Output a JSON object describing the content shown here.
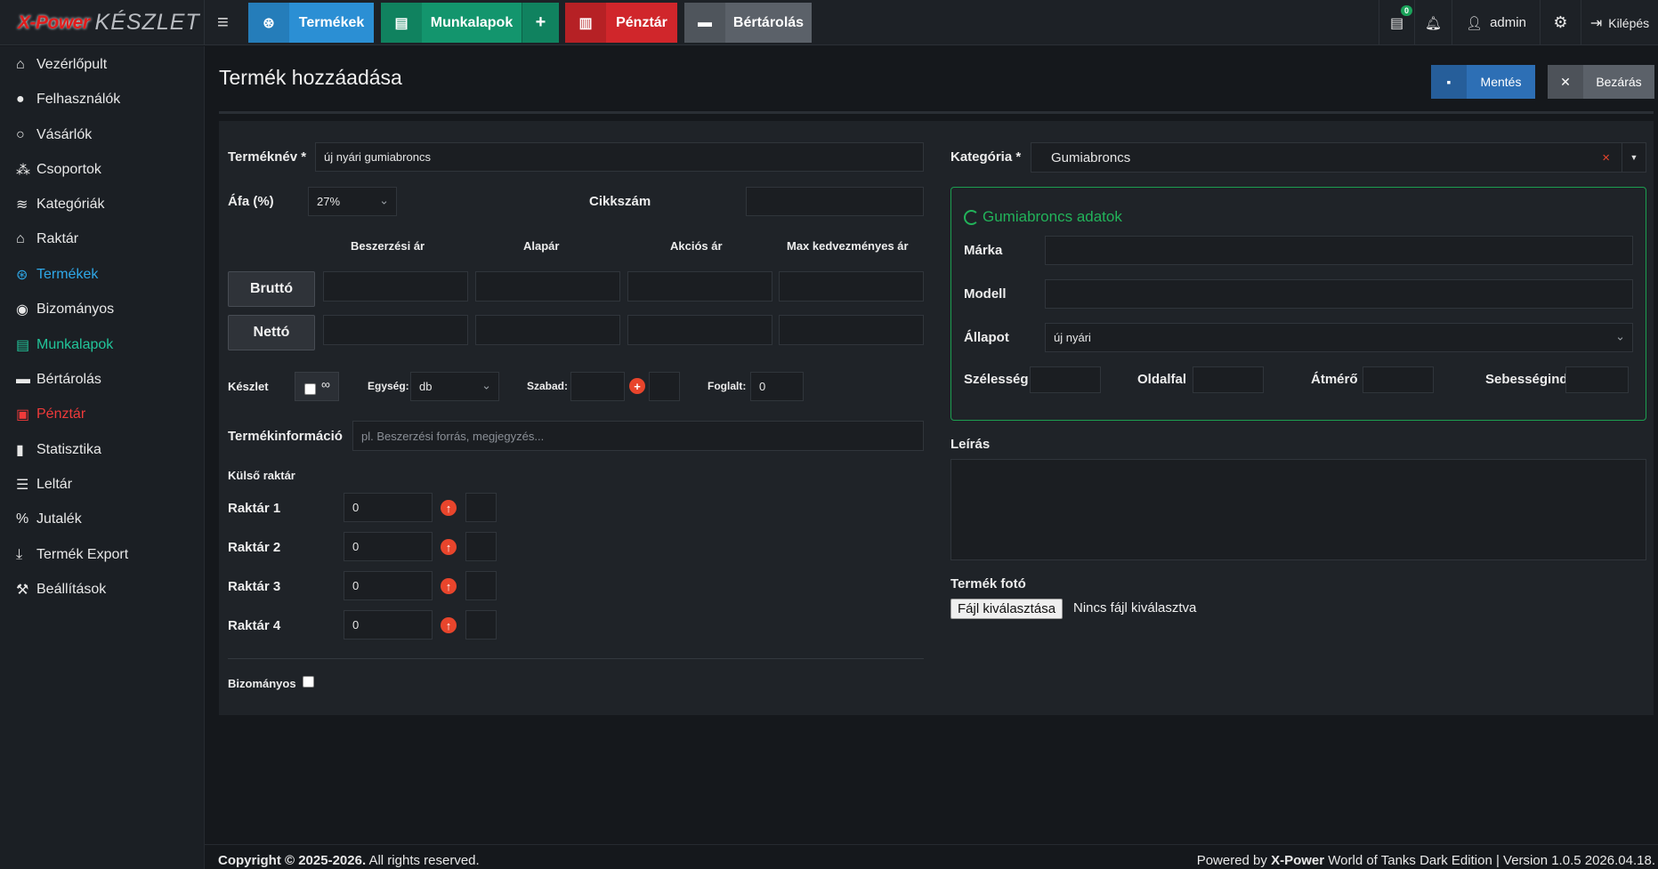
{
  "brand": {
    "logo_part1": "X-Power",
    "logo_part2": "KÉSZLET"
  },
  "topnav": {
    "buttons": [
      {
        "label": "Termékek",
        "color": "#2b8fd4"
      },
      {
        "label": "Munkalapok",
        "color": "#13956d",
        "extra": "+"
      },
      {
        "label": "Pénztár",
        "color": "#d0262b"
      },
      {
        "label": "Bértárolás",
        "color": "#5b6169"
      }
    ],
    "notif_badge": "0",
    "user": "admin",
    "logout": "Kilépés"
  },
  "sidebar": {
    "items": [
      {
        "label": "Vezérlőpult",
        "icon": "home-icon"
      },
      {
        "label": "Felhasználók",
        "icon": "user-icon"
      },
      {
        "label": "Vásárlók",
        "icon": "user-outline-icon"
      },
      {
        "label": "Csoportok",
        "icon": "users-icon"
      },
      {
        "label": "Kategóriák",
        "icon": "layers-icon"
      },
      {
        "label": "Raktár",
        "icon": "warehouse-icon"
      },
      {
        "label": "Termékek",
        "icon": "tire-icon",
        "color": "#2fa8e8"
      },
      {
        "label": "Bizományos",
        "icon": "user-circle-icon"
      },
      {
        "label": "Munkalapok",
        "icon": "file-icon",
        "color": "#22c59a"
      },
      {
        "label": "Bértárolás",
        "icon": "archive-icon"
      },
      {
        "label": "Pénztár",
        "icon": "money-icon",
        "color": "#ef3a3a"
      },
      {
        "label": "Statisztika",
        "icon": "chart-icon"
      },
      {
        "label": "Leltár",
        "icon": "list-icon"
      },
      {
        "label": "Jutalék",
        "icon": "percent-icon"
      },
      {
        "label": "Termék Export",
        "icon": "download-icon"
      },
      {
        "label": "Beállítások",
        "icon": "wrench-icon"
      }
    ]
  },
  "page": {
    "title": "Termék hozzáadása",
    "save": "Mentés",
    "close": "Bezárás"
  },
  "form": {
    "name_label": "Terméknév *",
    "name_value": "új nyári gumiabroncs",
    "vat_label": "Áfa (%)",
    "vat_value": "27%",
    "sku_label": "Cikkszám",
    "sku_value": "",
    "price_headers": [
      "Beszerzési ár",
      "Alapár",
      "Akciós ár",
      "Max kedvezményes ár"
    ],
    "gross_label": "Bruttó",
    "net_label": "Nettó",
    "stock_label": "Készlet",
    "infinity": "∞",
    "unit_label": "Egység:",
    "unit_value": "db",
    "free_label": "Szabad:",
    "booked_label": "Foglalt:",
    "booked_value": "0",
    "info_label": "Termékinformáció",
    "info_placeholder": "pl. Beszerzési forrás, megjegyzés...",
    "external_label": "Külső raktár",
    "warehouses": [
      {
        "label": "Raktár 1",
        "value": "0"
      },
      {
        "label": "Raktár 2",
        "value": "0"
      },
      {
        "label": "Raktár 3",
        "value": "0"
      },
      {
        "label": "Raktár 4",
        "value": "0"
      }
    ],
    "consign_label": "Bizományos"
  },
  "right": {
    "category_label": "Kategória *",
    "category_value": "Gumiabroncs",
    "clear": "×",
    "tire_title": "Gumiabroncs adatok",
    "brand_label": "Márka",
    "model_label": "Modell",
    "state_label": "Állapot",
    "state_value": "új nyári",
    "width_label": "Szélesség",
    "side_label": "Oldalfal",
    "diam_label": "Átmérő",
    "speed_label": "Sebességind",
    "desc_label": "Leírás",
    "photo_label": "Termék fotó",
    "file_button": "Fájl kiválasztása",
    "file_none": "Nincs fájl kiválasztva"
  },
  "footer": {
    "left_bold": "Copyright © 2025-2026.",
    "left": " All rights reserved.",
    "right_pre": "Powered by ",
    "right_bold": "X-Power",
    "right": " World of Tanks Dark Edition | Version 1.0.5 2026.04.18."
  }
}
